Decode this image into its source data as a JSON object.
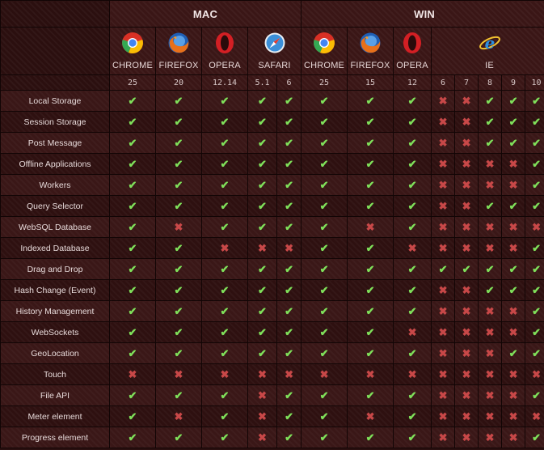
{
  "colors": {
    "background": "#2a1010",
    "check": "#7fe05a",
    "cross": "#c84848",
    "text": "#e7dada"
  },
  "header": {
    "mac": "MAC",
    "win": "WIN"
  },
  "browsers": {
    "mac": [
      {
        "name": "CHROME",
        "icon": "chrome-icon"
      },
      {
        "name": "FIREFOX",
        "icon": "firefox-icon"
      },
      {
        "name": "OPERA",
        "icon": "opera-icon"
      },
      {
        "name": "SAFARI",
        "icon": "safari-icon"
      }
    ],
    "win": [
      {
        "name": "CHROME",
        "icon": "chrome-icon"
      },
      {
        "name": "FIREFOX",
        "icon": "firefox-icon"
      },
      {
        "name": "OPERA",
        "icon": "opera-icon"
      },
      {
        "name": "IE",
        "icon": "ie-icon"
      }
    ]
  },
  "versions": [
    "25",
    "20",
    "12.14",
    "5.1",
    "6",
    "25",
    "15",
    "12",
    "6",
    "7",
    "8",
    "9",
    "10"
  ],
  "symbols": {
    "yes": "✔",
    "no": "✖"
  },
  "features": [
    {
      "name": "Local Storage",
      "support": [
        1,
        1,
        1,
        1,
        1,
        1,
        1,
        1,
        0,
        0,
        1,
        1,
        1
      ]
    },
    {
      "name": "Session Storage",
      "support": [
        1,
        1,
        1,
        1,
        1,
        1,
        1,
        1,
        0,
        0,
        1,
        1,
        1
      ]
    },
    {
      "name": "Post Message",
      "support": [
        1,
        1,
        1,
        1,
        1,
        1,
        1,
        1,
        0,
        0,
        1,
        1,
        1
      ]
    },
    {
      "name": "Offline Applications",
      "support": [
        1,
        1,
        1,
        1,
        1,
        1,
        1,
        1,
        0,
        0,
        0,
        0,
        1
      ]
    },
    {
      "name": "Workers",
      "support": [
        1,
        1,
        1,
        1,
        1,
        1,
        1,
        1,
        0,
        0,
        0,
        0,
        1
      ]
    },
    {
      "name": "Query Selector",
      "support": [
        1,
        1,
        1,
        1,
        1,
        1,
        1,
        1,
        0,
        0,
        1,
        1,
        1
      ]
    },
    {
      "name": "WebSQL Database",
      "support": [
        1,
        0,
        1,
        1,
        1,
        1,
        0,
        1,
        0,
        0,
        0,
        0,
        0
      ]
    },
    {
      "name": "Indexed Database",
      "support": [
        1,
        1,
        0,
        0,
        0,
        1,
        1,
        0,
        0,
        0,
        0,
        0,
        1
      ]
    },
    {
      "name": "Drag and Drop",
      "support": [
        1,
        1,
        1,
        1,
        1,
        1,
        1,
        1,
        1,
        1,
        1,
        1,
        1
      ]
    },
    {
      "name": "Hash Change (Event)",
      "support": [
        1,
        1,
        1,
        1,
        1,
        1,
        1,
        1,
        0,
        0,
        1,
        1,
        1
      ]
    },
    {
      "name": "History Management",
      "support": [
        1,
        1,
        1,
        1,
        1,
        1,
        1,
        1,
        0,
        0,
        0,
        0,
        1
      ]
    },
    {
      "name": "WebSockets",
      "support": [
        1,
        1,
        1,
        1,
        1,
        1,
        1,
        0,
        0,
        0,
        0,
        0,
        1
      ]
    },
    {
      "name": "GeoLocation",
      "support": [
        1,
        1,
        1,
        1,
        1,
        1,
        1,
        1,
        0,
        0,
        0,
        1,
        1
      ]
    },
    {
      "name": "Touch",
      "support": [
        0,
        0,
        0,
        0,
        0,
        0,
        0,
        0,
        0,
        0,
        0,
        0,
        0
      ]
    },
    {
      "name": "File API",
      "support": [
        1,
        1,
        1,
        0,
        1,
        1,
        1,
        1,
        0,
        0,
        0,
        0,
        1
      ]
    },
    {
      "name": "Meter element",
      "support": [
        1,
        0,
        1,
        0,
        1,
        1,
        0,
        1,
        0,
        0,
        0,
        0,
        0
      ]
    },
    {
      "name": "Progress element",
      "support": [
        1,
        1,
        1,
        0,
        1,
        1,
        1,
        1,
        0,
        0,
        0,
        0,
        1
      ]
    }
  ]
}
